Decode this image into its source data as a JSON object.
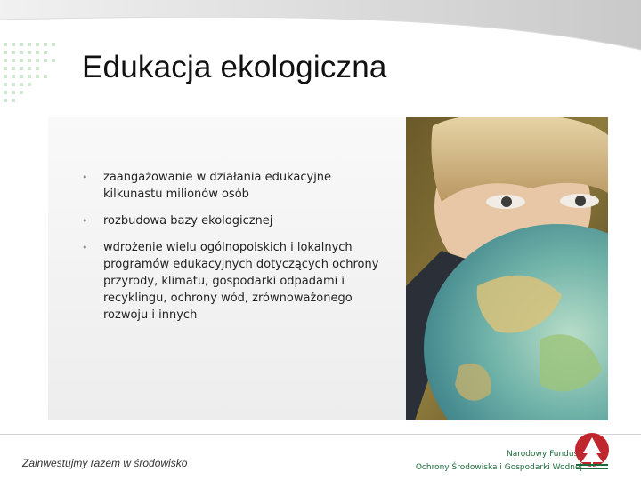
{
  "slide": {
    "title": "Edukacja ekologiczna",
    "bullets": [
      "zaangażowanie w działania edukacyjne kilkunastu milionów osób",
      "rozbudowa bazy ekologicznej",
      "wdrożenie wielu ogólnopolskich i lokalnych programów edukacyjnych dotyczących ochrony przyrody, klimatu, gospodarki odpadami i recyklingu, ochrony wód, zrównoważonego rozwoju i innych"
    ],
    "bullet_glyph": "•"
  },
  "footer": {
    "tagline": "Zainwestujmy razem w środowisko",
    "fund_line1": "Narodowy Fundusz",
    "fund_line2": "Ochrony Środowiska i Gospodarki Wodnej"
  },
  "colors": {
    "accent_green": "#1d6a3a",
    "logo_red": "#c0262d"
  },
  "icons": [
    "dot-grid-decoration",
    "fund-logo-icon"
  ]
}
